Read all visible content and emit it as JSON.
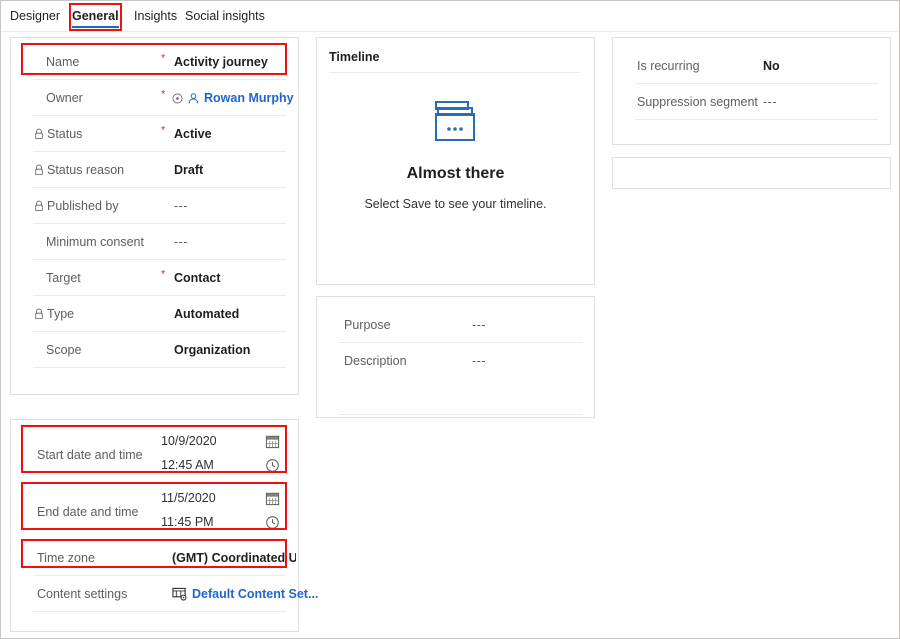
{
  "tabs": [
    {
      "label": "Designer",
      "active": false
    },
    {
      "label": "General",
      "active": true
    },
    {
      "label": "Insights",
      "active": false
    },
    {
      "label": "Social insights",
      "active": false
    }
  ],
  "colors": {
    "accent_blue": "#2266cc",
    "annotation_red": "#ee1111",
    "required_red": "#d13438",
    "label_gray": "#605e5c",
    "value_dark": "#201f1e",
    "card_border": "#e1dfdd"
  },
  "main_card": {
    "rows": [
      {
        "label": "Name",
        "value": "Activity journey",
        "required": true,
        "locked": false,
        "style": "bold"
      },
      {
        "label": "Owner",
        "value": "Rowan Murphy",
        "required": true,
        "locked": false,
        "style": "link"
      },
      {
        "label": "Status",
        "value": "Active",
        "required": true,
        "locked": true,
        "style": "bold"
      },
      {
        "label": "Status reason",
        "value": "Draft",
        "required": false,
        "locked": true,
        "style": "bold"
      },
      {
        "label": "Published by",
        "value": "---",
        "required": false,
        "locked": true,
        "style": "plain"
      },
      {
        "label": "Minimum consent",
        "value": "---",
        "required": false,
        "locked": false,
        "style": "plain"
      },
      {
        "label": "Target",
        "value": "Contact",
        "required": true,
        "locked": false,
        "style": "bold"
      },
      {
        "label": "Type",
        "value": "Automated",
        "required": false,
        "locked": true,
        "style": "bold"
      },
      {
        "label": "Scope",
        "value": "Organization",
        "required": false,
        "locked": false,
        "style": "bold"
      }
    ],
    "required_marker": "*"
  },
  "dates_card": {
    "start": {
      "label": "Start date and time",
      "date": "10/9/2020",
      "time": "12:45 AM"
    },
    "end": {
      "label": "End date and time",
      "date": "11/5/2020",
      "time": "11:45 PM"
    },
    "timezone": {
      "label": "Time zone",
      "value": "(GMT) Coordinated Universal Time"
    },
    "content_settings": {
      "label": "Content settings",
      "value": "Default Content Set..."
    }
  },
  "timeline_card": {
    "header": "Timeline",
    "empty_title": "Almost there",
    "empty_subtitle": "Select Save to see your timeline."
  },
  "purpose_card": {
    "rows": [
      {
        "label": "Purpose",
        "value": "---"
      },
      {
        "label": "Description",
        "value": "---"
      }
    ]
  },
  "recurring_card": {
    "rows": [
      {
        "label": "Is recurring",
        "value": "No",
        "style": "bold"
      },
      {
        "label": "Suppression segment",
        "value": "---",
        "style": "plain"
      }
    ]
  },
  "icons": {
    "lock": "lock-icon",
    "person": "person-icon",
    "info_circle": "info-circle-icon",
    "calendar": "calendar-icon",
    "clock": "clock-icon",
    "content_settings": "content-settings-icon",
    "folder_empty": "folder-empty-state-icon"
  }
}
